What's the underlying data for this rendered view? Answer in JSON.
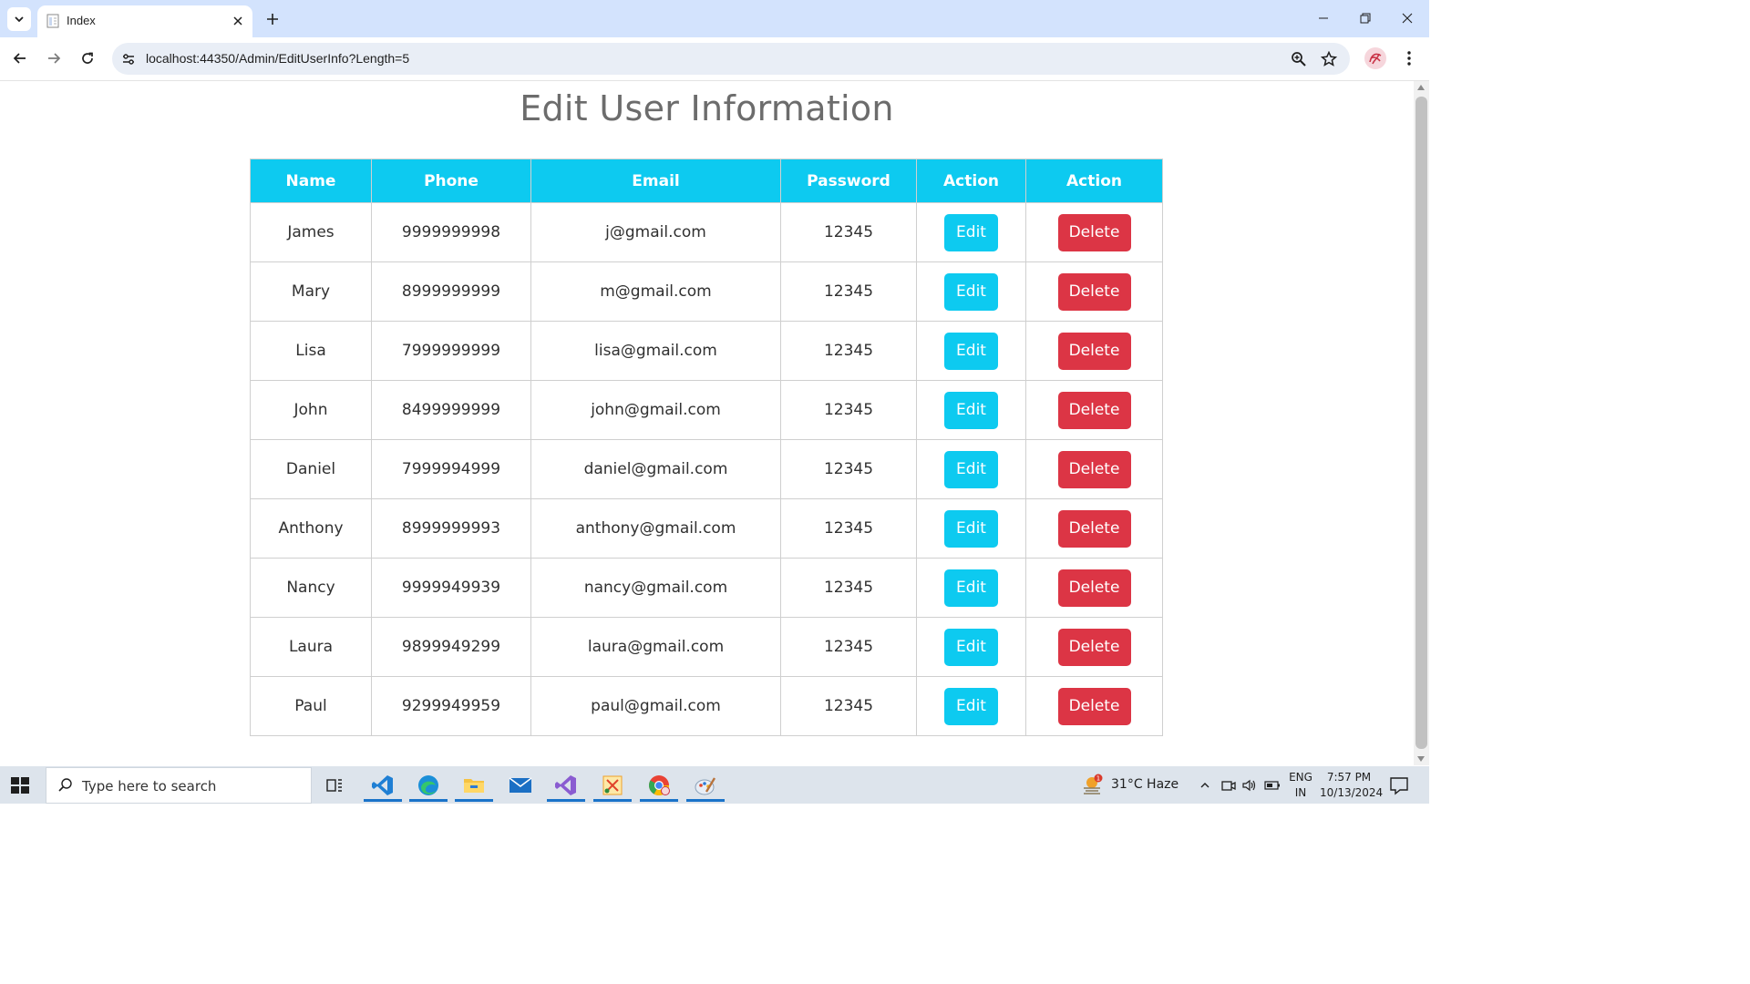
{
  "browser": {
    "tab_title": "Index",
    "url": "localhost:44350/Admin/EditUserInfo?Length=5"
  },
  "page": {
    "title": "Edit User Information"
  },
  "table": {
    "headers": [
      "Name",
      "Phone",
      "Email",
      "Password",
      "Action",
      "Action"
    ],
    "edit_label": "Edit",
    "delete_label": "Delete",
    "rows": [
      {
        "name": "James",
        "phone": "9999999998",
        "email": "j@gmail.com",
        "password": "12345"
      },
      {
        "name": "Mary",
        "phone": "8999999999",
        "email": "m@gmail.com",
        "password": "12345"
      },
      {
        "name": "Lisa",
        "phone": "7999999999",
        "email": "lisa@gmail.com",
        "password": "12345"
      },
      {
        "name": "John",
        "phone": "8499999999",
        "email": "john@gmail.com",
        "password": "12345"
      },
      {
        "name": "Daniel",
        "phone": "7999994999",
        "email": "daniel@gmail.com",
        "password": "12345"
      },
      {
        "name": "Anthony",
        "phone": "8999999993",
        "email": "anthony@gmail.com",
        "password": "12345"
      },
      {
        "name": "Nancy",
        "phone": "9999949939",
        "email": "nancy@gmail.com",
        "password": "12345"
      },
      {
        "name": "Laura",
        "phone": "9899949299",
        "email": "laura@gmail.com",
        "password": "12345"
      },
      {
        "name": "Paul",
        "phone": "9299949959",
        "email": "paul@gmail.com",
        "password": "12345"
      }
    ]
  },
  "taskbar": {
    "search_placeholder": "Type here to search",
    "weather_badge": "1",
    "weather": "31°C  Haze",
    "lang_line1": "ENG",
    "lang_line2": "IN",
    "time": "7:57 PM",
    "date": "10/13/2024"
  },
  "colors": {
    "header_cyan": "#0dcaf0",
    "delete_red": "#dc3545",
    "title_gray": "#6c6c6c",
    "tabstrip": "#d3e3fd"
  }
}
